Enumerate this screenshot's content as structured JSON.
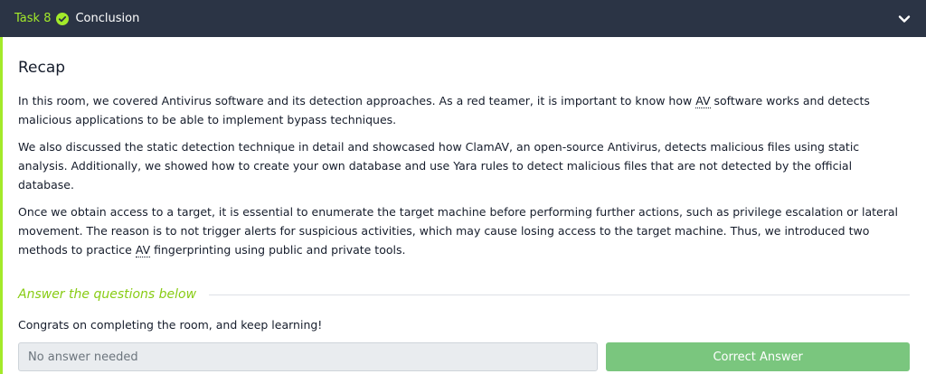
{
  "task": {
    "number_label": "Task 8",
    "title": "Conclusion",
    "completed": true,
    "status_icon": "check-circle-icon",
    "toggle_icon": "chevron-down-icon"
  },
  "content": {
    "heading": "Recap",
    "p1_a": "In this room, we covered Antivirus software and its detection approaches. As a red teamer, it is important to know how ",
    "p1_abbr": "AV",
    "p1_b": " software works and detects malicious applications to be able to implement bypass techniques.",
    "p2": "We also discussed the static detection technique in detail and showcased how ClamAV, an open-source Antivirus, detects malicious files using static analysis. Additionally, we showed how to create your own database and use Yara rules to detect malicious files that are not detected by the official database.",
    "p3_a": "Once we obtain access to a target, it is essential to enumerate the target machine before performing further actions, such as privilege escalation or lateral movement. The reason is to not trigger alerts for suspicious activities, which may cause losing access to the target machine. Thus, we introduced two methods to practice ",
    "p3_abbr": "AV",
    "p3_b": " fingerprinting using public and private tools."
  },
  "questions": {
    "heading": "Answer the questions below",
    "items": [
      {
        "text": "Congrats on completing the room, and keep learning!",
        "answer_placeholder": "No answer needed",
        "button_label": "Correct Answer"
      }
    ]
  },
  "colors": {
    "header_bg": "#2b3445",
    "accent_green": "#a3ea2a",
    "button_green": "#7ac67e",
    "heading_green": "#88cc14",
    "text_dark": "#151c2b",
    "input_bg": "#e9ecef"
  }
}
